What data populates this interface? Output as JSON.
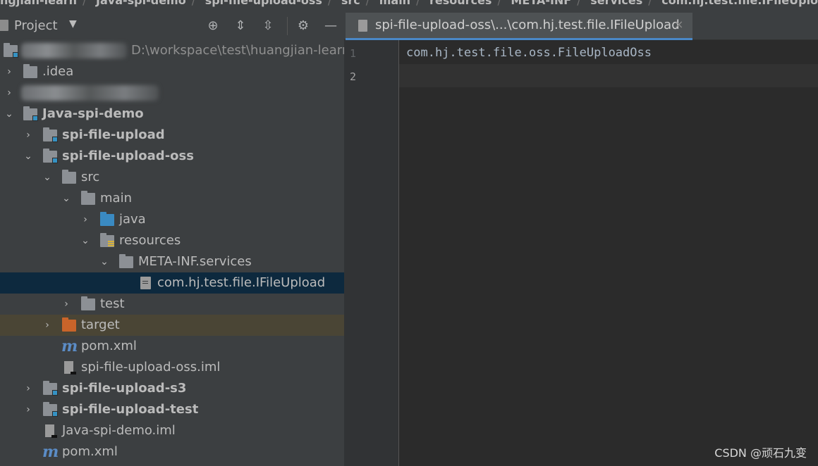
{
  "breadcrumb": {
    "items": [
      "ngjian-learn",
      "Java-spi-demo",
      "spi-file-upload-oss",
      "src",
      "main",
      "resources",
      "META-INF",
      "services",
      "com.hj.test.file.IFileUpload"
    ]
  },
  "panel": {
    "title": "Project",
    "caret": "▼",
    "buttons": {
      "locate": "⊕",
      "expand": "⇕",
      "collapse": "⇳",
      "settings": "⚙",
      "hide": "—"
    }
  },
  "tree": {
    "root_path": "D:\\workspace\\test\\huangjian-learn",
    "idea": ".idea",
    "java_spi_demo": "Java-spi-demo",
    "spi_file_upload": "spi-file-upload",
    "spi_file_upload_oss": "spi-file-upload-oss",
    "src": "src",
    "main": "main",
    "java": "java",
    "resources": "resources",
    "meta_inf": "META-INF.services",
    "ifileupload": "com.hj.test.file.IFileUpload",
    "test": "test",
    "target": "target",
    "pom_oss": "pom.xml",
    "iml_oss": "spi-file-upload-oss.iml",
    "spi_file_upload_s3": "spi-file-upload-s3",
    "spi_file_upload_test": "spi-file-upload-test",
    "demo_iml": "Java-spi-demo.iml",
    "pom_root": "pom.xml",
    "arrow_expanded": "⌄",
    "arrow_collapsed": "›",
    "maven_glyph": "m"
  },
  "editor": {
    "tab_label": "spi-file-upload-oss\\...\\com.hj.test.file.IFileUpload",
    "tab_close": "×",
    "lines": [
      {
        "num": "1",
        "text": "com.hj.test.file.oss.FileUploadOss"
      },
      {
        "num": "2",
        "text": ""
      }
    ]
  },
  "watermark": "CSDN @顽石九变",
  "colors": {
    "selection": "#0d293e",
    "excluded": "#4a4535",
    "tab_underline": "#4a88c7",
    "folder_blue": "#3a8ac2",
    "folder_orange": "#c9642a"
  }
}
